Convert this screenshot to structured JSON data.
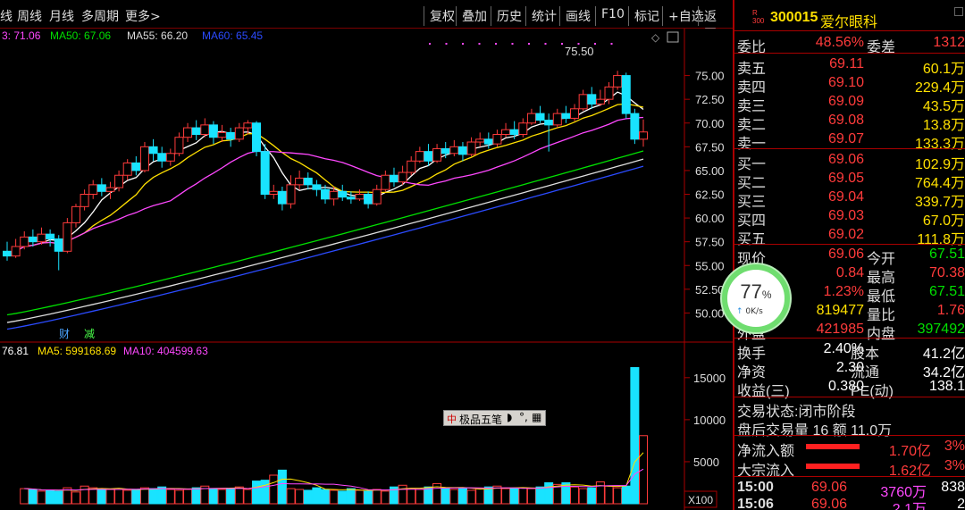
{
  "toolbar": {
    "periods": [
      "线",
      "周线",
      "月线",
      "多周期",
      "更多>"
    ],
    "buttons": [
      "复权",
      "叠加",
      "历史",
      "统计",
      "画线",
      "F10",
      "标记",
      "+自选",
      "返回"
    ]
  },
  "ma_legend": [
    {
      "text": "3: 71.06",
      "color": "#ff48ff"
    },
    {
      "text": "MA50: 67.06",
      "color": "#00e000"
    },
    {
      "text": "MA55: 66.20",
      "color": "#dddddd"
    },
    {
      "text": "MA60: 65.45",
      "color": "#2b4bff"
    }
  ],
  "peak_label": "75.50",
  "markers": [
    "财",
    "减"
  ],
  "vol_legend": [
    {
      "text": "76.81",
      "color": "#ffffff"
    },
    {
      "text": "MA5: 599168.69",
      "color": "#ffe000"
    },
    {
      "text": "MA10: 404599.63",
      "color": "#ff48ff"
    }
  ],
  "vol_multiplier": "X100",
  "popup": {
    "label": "极品五笔"
  },
  "net_widget": {
    "percent": "77",
    "percent_sign": "%",
    "speed": "0K/s"
  },
  "quote": {
    "market_badge": "R\n300",
    "code": "300015",
    "name": "爱尔眼科",
    "wb_label": "委比",
    "wb_value": "48.56%",
    "wc_label": "委差",
    "wc_value": "1312",
    "asks": [
      {
        "label": "卖五",
        "price": "69.11",
        "vol": "60.1万"
      },
      {
        "label": "卖四",
        "price": "69.10",
        "vol": "229.4万"
      },
      {
        "label": "卖三",
        "price": "69.09",
        "vol": "43.5万"
      },
      {
        "label": "卖二",
        "price": "69.08",
        "vol": "13.8万"
      },
      {
        "label": "卖一",
        "price": "69.07",
        "vol": "133.3万"
      }
    ],
    "bids": [
      {
        "label": "买一",
        "price": "69.06",
        "vol": "102.9万"
      },
      {
        "label": "买二",
        "price": "69.05",
        "vol": "764.4万"
      },
      {
        "label": "买三",
        "price": "69.04",
        "vol": "339.7万"
      },
      {
        "label": "买四",
        "price": "69.03",
        "vol": "67.0万"
      },
      {
        "label": "买五",
        "price": "69.02",
        "vol": "111.8万"
      }
    ],
    "stats": [
      {
        "l1": "现价",
        "v1": "69.06",
        "c1": "red",
        "l2": "今开",
        "v2": "67.51",
        "c2": "green"
      },
      {
        "l1": "涨跌",
        "v1": "0.84",
        "c1": "red",
        "l2": "最高",
        "v2": "70.38",
        "c2": "red"
      },
      {
        "l1": "涨幅",
        "v1": "1.23%",
        "c1": "red",
        "l2": "最低",
        "v2": "67.51",
        "c2": "green"
      },
      {
        "l1": "总量",
        "v1": "819477",
        "c1": "yellow",
        "l2": "量比",
        "v2": "1.76",
        "c2": "red"
      },
      {
        "l1": "外盘",
        "v1": "421985",
        "c1": "red",
        "l2": "内盘",
        "v2": "397492",
        "c2": "green"
      }
    ],
    "stats2": [
      {
        "l1": "换手",
        "v1": "2.40%",
        "l2": "股本",
        "v2": "41.2亿"
      },
      {
        "l1": "净资",
        "v1": "2.30",
        "l2": "流通",
        "v2": "34.2亿"
      },
      {
        "l1": "收益(三)",
        "v1": "0.380",
        "l2": "PE(动)",
        "v2": "138.1"
      }
    ],
    "trade_status": "交易状态:闭市阶段",
    "after_hours": "盘后交易量 16 额 11.0万",
    "flows": [
      {
        "label": "净流入额",
        "value": "1.70亿",
        "pct": "3%"
      },
      {
        "label": "大宗流入",
        "value": "1.62亿",
        "pct": "3%"
      }
    ],
    "ticks": [
      {
        "time": "15:00",
        "price": "69.06",
        "vol": "3760万",
        "n": "838"
      },
      {
        "time": "15:06",
        "price": "69.06",
        "vol": "2.1万",
        "n": "2"
      }
    ]
  },
  "chart_data": {
    "type": "candlestick",
    "price_axis_ticks": [
      "75.00",
      "72.50",
      "70.00",
      "67.50",
      "65.00",
      "62.50",
      "60.00",
      "57.50",
      "55.00",
      "52.50",
      "50.00"
    ],
    "price_ylim": [
      47.5,
      77.5
    ],
    "volume_axis_ticks": [
      "15000",
      "10000",
      "5000"
    ],
    "volume_ylim": [
      0,
      17000
    ],
    "candles": [
      [
        56.5,
        56.0,
        57.5,
        55.5
      ],
      [
        56.0,
        57.0,
        57.8,
        55.8
      ],
      [
        57.0,
        58.0,
        58.6,
        56.7
      ],
      [
        58.0,
        57.5,
        58.8,
        57.0
      ],
      [
        57.5,
        58.3,
        59.0,
        57.2
      ],
      [
        58.3,
        57.8,
        58.8,
        57.0
      ],
      [
        57.8,
        56.5,
        58.2,
        54.5
      ],
      [
        56.5,
        59.5,
        60.0,
        56.3
      ],
      [
        59.5,
        61.2,
        61.5,
        59.0
      ],
      [
        61.2,
        62.5,
        63.0,
        60.8
      ],
      [
        62.5,
        63.5,
        64.0,
        62.0
      ],
      [
        63.5,
        62.8,
        64.2,
        62.3
      ],
      [
        62.8,
        63.2,
        63.8,
        62.0
      ],
      [
        63.2,
        64.5,
        65.0,
        62.8
      ],
      [
        64.5,
        65.8,
        66.2,
        64.0
      ],
      [
        65.8,
        65.0,
        66.5,
        64.5
      ],
      [
        65.0,
        67.5,
        68.0,
        64.8
      ],
      [
        67.5,
        66.8,
        68.3,
        66.0
      ],
      [
        66.8,
        66.0,
        67.5,
        65.3
      ],
      [
        66.0,
        66.8,
        67.3,
        65.5
      ],
      [
        66.8,
        68.5,
        69.0,
        66.5
      ],
      [
        68.5,
        69.5,
        70.0,
        68.0
      ],
      [
        69.5,
        68.8,
        70.3,
        68.2
      ],
      [
        68.8,
        69.8,
        70.5,
        68.5
      ],
      [
        69.8,
        68.5,
        70.2,
        67.8
      ],
      [
        68.5,
        69.0,
        69.8,
        68.0
      ],
      [
        69.0,
        68.3,
        69.5,
        67.5
      ],
      [
        68.3,
        69.5,
        70.0,
        68.0
      ],
      [
        69.5,
        70.0,
        70.3,
        68.8
      ],
      [
        70.0,
        67.0,
        70.2,
        66.5
      ],
      [
        67.0,
        62.5,
        67.8,
        62.0
      ],
      [
        62.5,
        62.8,
        63.5,
        62.0
      ],
      [
        62.8,
        61.5,
        63.3,
        60.8
      ],
      [
        61.5,
        63.5,
        64.5,
        61.0
      ],
      [
        63.5,
        64.2,
        65.0,
        63.0
      ],
      [
        64.2,
        63.5,
        64.8,
        63.0
      ],
      [
        63.5,
        63.0,
        64.0,
        62.3
      ],
      [
        63.0,
        62.0,
        63.5,
        61.5
      ],
      [
        62.0,
        62.8,
        63.3,
        61.3
      ],
      [
        62.8,
        62.2,
        63.5,
        61.8
      ],
      [
        62.2,
        62.0,
        62.8,
        61.5
      ],
      [
        62.0,
        62.5,
        63.0,
        61.8
      ],
      [
        62.5,
        61.5,
        62.8,
        61.0
      ],
      [
        61.5,
        63.0,
        63.5,
        61.3
      ],
      [
        63.0,
        64.5,
        65.0,
        62.8
      ],
      [
        64.5,
        63.8,
        65.3,
        63.3
      ],
      [
        63.8,
        64.8,
        65.5,
        63.5
      ],
      [
        64.8,
        66.0,
        66.5,
        64.5
      ],
      [
        66.0,
        67.0,
        67.5,
        65.8
      ],
      [
        67.0,
        66.0,
        67.8,
        65.5
      ],
      [
        66.0,
        67.3,
        67.8,
        65.8
      ],
      [
        67.3,
        66.8,
        68.0,
        66.3
      ],
      [
        66.8,
        67.5,
        68.2,
        66.5
      ],
      [
        67.5,
        66.7,
        68.0,
        66.0
      ],
      [
        66.7,
        68.0,
        68.5,
        66.5
      ],
      [
        68.0,
        68.3,
        69.0,
        67.5
      ],
      [
        68.3,
        67.8,
        69.0,
        67.3
      ],
      [
        67.8,
        68.8,
        69.3,
        67.5
      ],
      [
        68.8,
        69.3,
        70.0,
        68.5
      ],
      [
        69.3,
        68.8,
        70.2,
        68.3
      ],
      [
        68.8,
        70.0,
        70.5,
        68.5
      ],
      [
        70.0,
        71.0,
        71.5,
        69.8
      ],
      [
        71.0,
        70.3,
        71.8,
        70.0
      ],
      [
        70.3,
        69.8,
        71.0,
        67.0
      ],
      [
        69.8,
        71.0,
        71.5,
        69.5
      ],
      [
        71.0,
        70.5,
        71.8,
        70.0
      ],
      [
        70.5,
        71.5,
        72.0,
        70.2
      ],
      [
        71.5,
        73.0,
        73.5,
        71.3
      ],
      [
        73.0,
        72.0,
        73.8,
        71.5
      ],
      [
        72.0,
        72.5,
        73.5,
        71.8
      ],
      [
        72.5,
        73.8,
        74.3,
        72.0
      ],
      [
        73.8,
        75.0,
        75.5,
        73.5
      ],
      [
        75.0,
        71.0,
        75.3,
        70.5
      ],
      [
        71.0,
        68.3,
        71.5,
        67.8
      ],
      [
        68.3,
        69.06,
        70.38,
        67.51
      ]
    ],
    "volume": [
      1800,
      1700,
      1500,
      1600,
      1500,
      1900,
      1400,
      2100,
      1900,
      1800,
      1700,
      1700,
      1600,
      1700,
      1900,
      1800,
      2000,
      1700,
      1600,
      1700,
      1900,
      2100,
      1800,
      1700,
      1800,
      2000,
      1700,
      2700,
      2800,
      3400,
      4000,
      1800,
      1700,
      1600,
      1900,
      1700,
      1600,
      1500,
      1800,
      1600,
      1500,
      1700,
      1500,
      2000,
      2200,
      1800,
      1700,
      2000,
      2400,
      1800,
      1700,
      1800,
      1600,
      1800,
      2000,
      2100,
      1800,
      1800,
      1900,
      1800,
      2000,
      2500,
      2300,
      2500,
      2000,
      1800,
      1900,
      2600,
      2100,
      1900,
      2100,
      16200,
      8100
    ]
  }
}
